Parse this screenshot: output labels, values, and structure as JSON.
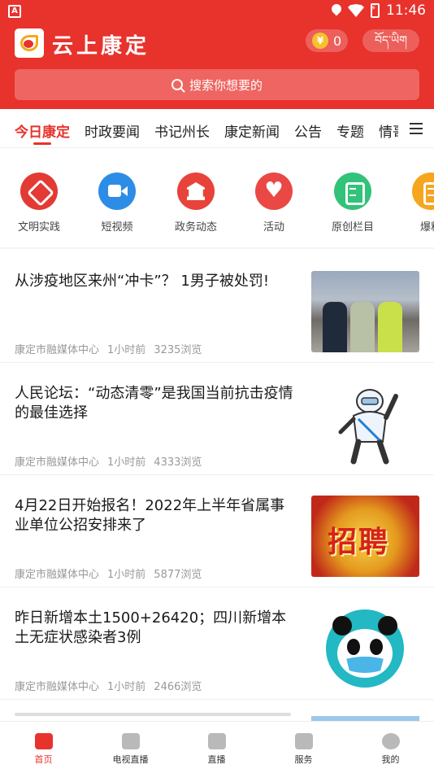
{
  "status_bar": {
    "time": "11:46"
  },
  "header": {
    "app_title": "云上康定",
    "coin_symbol": "¥",
    "coin_count": "0",
    "lang_label": "བོད་ཡིག",
    "search_placeholder": "搜索你想要的",
    "accent_color": "#e8322c"
  },
  "tabs": [
    {
      "label": "今日康定",
      "active": true
    },
    {
      "label": "时政要闻"
    },
    {
      "label": "书记州长"
    },
    {
      "label": "康定新闻"
    },
    {
      "label": "公告"
    },
    {
      "label": "专题"
    },
    {
      "label": "情哥"
    }
  ],
  "quick_links": [
    {
      "label": "文明实践",
      "icon": "hand-heart-icon",
      "color": "#e33a34"
    },
    {
      "label": "短视频",
      "icon": "video-camera-icon",
      "color": "#2d8de6"
    },
    {
      "label": "政务动态",
      "icon": "government-building-icon",
      "color": "#e8433a"
    },
    {
      "label": "活动",
      "icon": "heart-icon",
      "color": "#e94845"
    },
    {
      "label": "原创栏目",
      "icon": "document-icon",
      "color": "#33c27a"
    },
    {
      "label": "爆料",
      "icon": "document-icon",
      "color": "#f6a51e"
    }
  ],
  "news": [
    {
      "title": "从涉疫地区来州“冲卡”？ 1男子被处罚!",
      "source": "康定市融媒体中心",
      "time": "1小时前",
      "views": "3235浏览"
    },
    {
      "title": " 人民论坛：“动态清零”是我国当前抗击疫情的最佳选择",
      "source": "康定市融媒体中心",
      "time": "1小时前",
      "views": "4333浏览"
    },
    {
      "title": "4月22日开始报名！2022年上半年省属事业单位公招安排来了",
      "source": "康定市融媒体中心",
      "time": "1小时前",
      "views": "5877浏览",
      "thumb_text": "招聘"
    },
    {
      "title": "昨日新增本土1500+26420；四川新增本土无症状感染者3例",
      "source": "康定市融媒体中心",
      "time": "1小时前",
      "views": "2466浏览"
    }
  ],
  "bottom_nav": [
    {
      "label": "首页",
      "icon": "home-icon",
      "active": true
    },
    {
      "label": "电视直播",
      "icon": "tv-icon"
    },
    {
      "label": "直播",
      "icon": "live-video-icon"
    },
    {
      "label": "服务",
      "icon": "grid-icon"
    },
    {
      "label": "我的",
      "icon": "profile-icon"
    }
  ]
}
